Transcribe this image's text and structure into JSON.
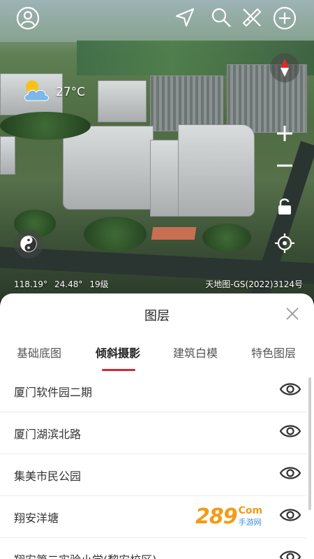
{
  "weather": {
    "temperature": "27°C",
    "icon": "partly-cloudy-icon"
  },
  "map": {
    "latitude_longitude": [
      "118.19°",
      "24.48°"
    ],
    "zoom_level": "19级",
    "attribution": "天地图-GS(2022)3124号"
  },
  "toolbar": {
    "icons": [
      "user-icon",
      "navigate-icon",
      "search-icon",
      "measure-tools-icon",
      "add-icon"
    ]
  },
  "map_controls": {
    "icons": [
      "compass-icon",
      "zoom-in-icon",
      "zoom-out-icon",
      "lock-icon",
      "locate-icon",
      "yin-yang-icon"
    ]
  },
  "layer_panel": {
    "title": "图层",
    "tabs": [
      "基础底图",
      "倾斜摄影",
      "建筑白模",
      "特色图层"
    ],
    "active_tab_index": 1,
    "items": [
      "厦门软件园二期",
      "厦门湖滨北路",
      "集美市民公园",
      "翔安洋塘",
      "翔安第二实验小学(黎安校区)"
    ]
  },
  "watermark": {
    "main": "289",
    "suffix": "Com",
    "sub": "手游网"
  },
  "colors": {
    "accent": "#d6263a",
    "panel_bg": "#ffffff"
  }
}
